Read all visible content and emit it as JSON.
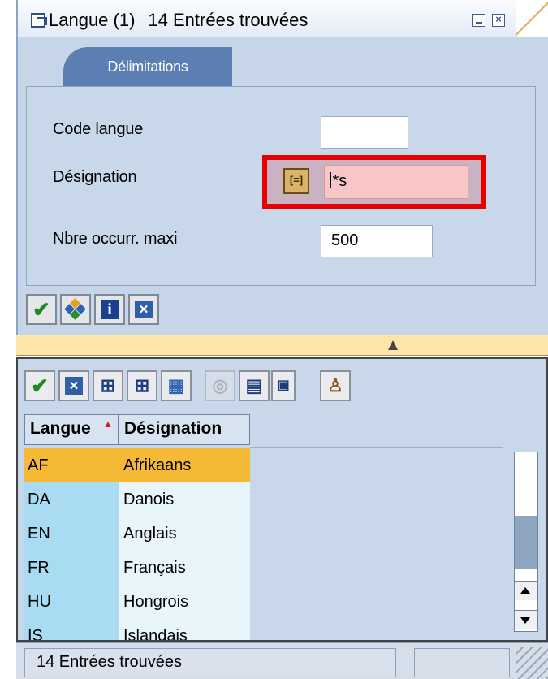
{
  "window": {
    "title": "Langue (1)",
    "count_text": "14 Entrées trouvées",
    "minimize_label": "",
    "close_label": "×"
  },
  "tab": {
    "label": "Délimitations"
  },
  "fields": {
    "code_langue": {
      "label": "Code langue",
      "value": ""
    },
    "designation": {
      "label": "Désignation",
      "value": "*s",
      "option_icon": "select-option-icon"
    },
    "max_hits": {
      "label": "Nbre occurr. maxi",
      "value": "500"
    }
  },
  "search_buttons": [
    "check-icon",
    "multiple-selection-icon",
    "info-icon",
    "cancel-icon"
  ],
  "result_toolbar": [
    "check-icon",
    "cancel-icon",
    "find-icon",
    "find-next-icon",
    "export-icon",
    "help-icon-disabled",
    "print-icon",
    "layout-icon",
    "settings-icon"
  ],
  "table": {
    "headers": [
      "Langue",
      "Désignation"
    ],
    "sorted_column": "Langue",
    "rows": [
      {
        "code": "AF",
        "name": "Afrikaans",
        "selected": true
      },
      {
        "code": "DA",
        "name": "Danois",
        "selected": false
      },
      {
        "code": "EN",
        "name": "Anglais",
        "selected": false
      },
      {
        "code": "FR",
        "name": "Français",
        "selected": false
      },
      {
        "code": "HU",
        "name": "Hongrois",
        "selected": false
      },
      {
        "code": "IS",
        "name": "Islandais",
        "selected": false
      }
    ]
  },
  "status": {
    "text": "14 Entrées trouvées"
  },
  "colors": {
    "accent_red": "#e60000",
    "selection": "#f5b935",
    "panel_blue": "#c6d5e8"
  }
}
